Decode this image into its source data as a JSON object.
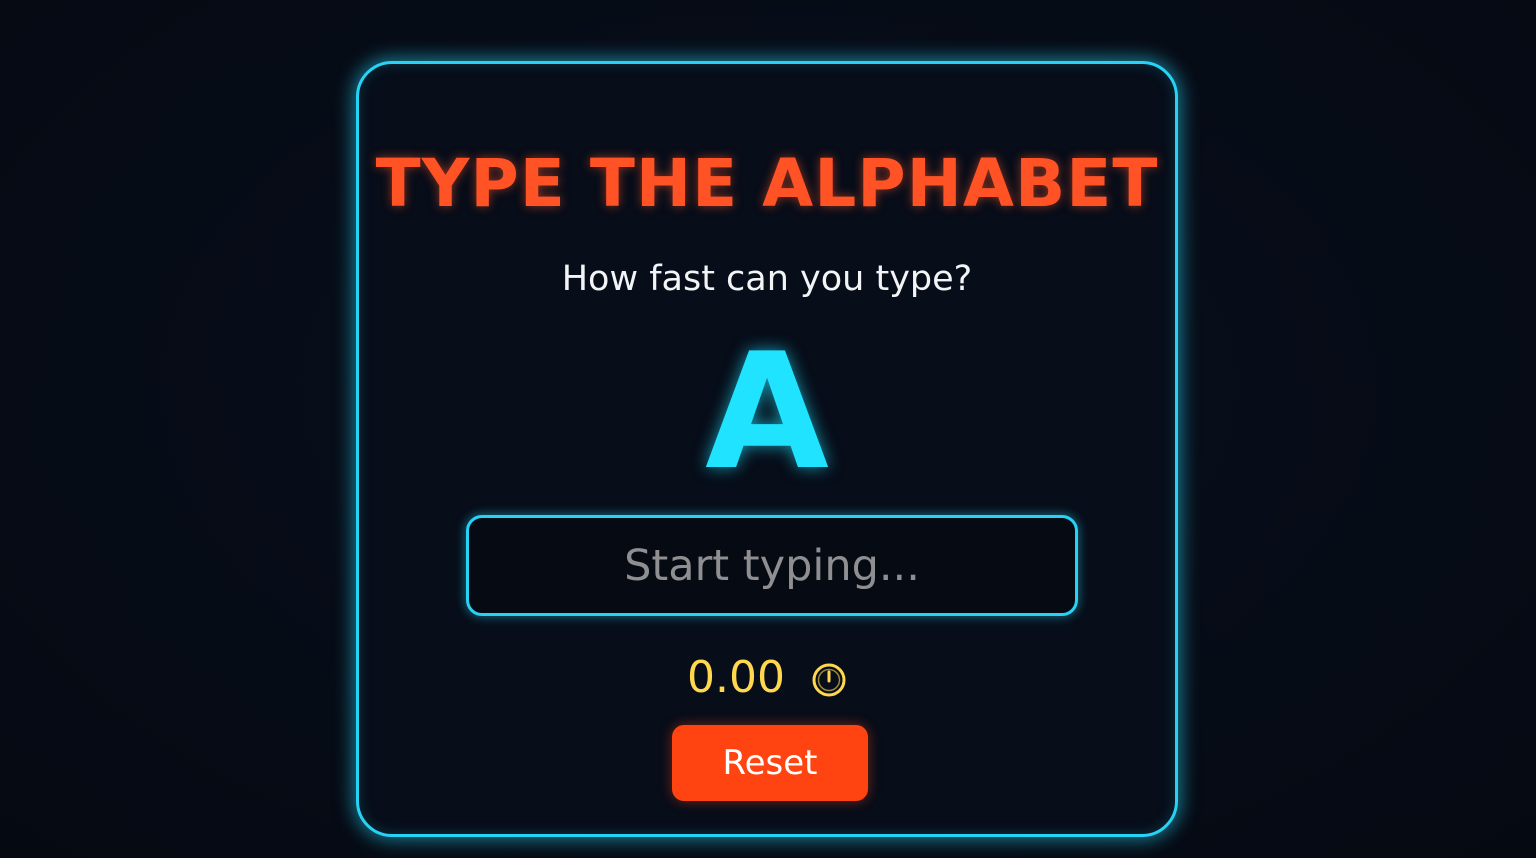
{
  "game": {
    "title": "TYPE THE ALPHABET",
    "subtitle": "How fast can you type?",
    "current_letter": "A",
    "input": {
      "value": "",
      "placeholder": "Start typing..."
    },
    "timer": {
      "value": "0.00",
      "icon": "stopwatch-icon"
    },
    "reset_label": "Reset"
  },
  "colors": {
    "accent_cyan": "#27d3f5",
    "title_orange": "#ff5326",
    "timer_yellow": "#ffd84d",
    "button_red": "#ff4412",
    "background": "#060b14"
  }
}
